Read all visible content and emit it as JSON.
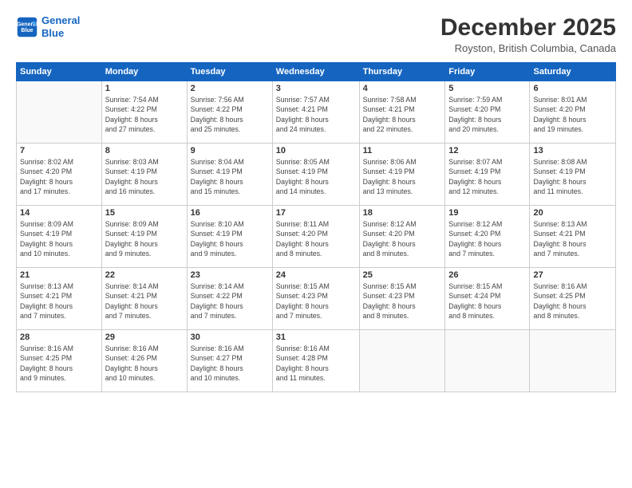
{
  "logo": {
    "line1": "General",
    "line2": "Blue"
  },
  "title": "December 2025",
  "location": "Royston, British Columbia, Canada",
  "days_header": [
    "Sunday",
    "Monday",
    "Tuesday",
    "Wednesday",
    "Thursday",
    "Friday",
    "Saturday"
  ],
  "weeks": [
    [
      {
        "num": "",
        "info": ""
      },
      {
        "num": "1",
        "info": "Sunrise: 7:54 AM\nSunset: 4:22 PM\nDaylight: 8 hours\nand 27 minutes."
      },
      {
        "num": "2",
        "info": "Sunrise: 7:56 AM\nSunset: 4:22 PM\nDaylight: 8 hours\nand 25 minutes."
      },
      {
        "num": "3",
        "info": "Sunrise: 7:57 AM\nSunset: 4:21 PM\nDaylight: 8 hours\nand 24 minutes."
      },
      {
        "num": "4",
        "info": "Sunrise: 7:58 AM\nSunset: 4:21 PM\nDaylight: 8 hours\nand 22 minutes."
      },
      {
        "num": "5",
        "info": "Sunrise: 7:59 AM\nSunset: 4:20 PM\nDaylight: 8 hours\nand 20 minutes."
      },
      {
        "num": "6",
        "info": "Sunrise: 8:01 AM\nSunset: 4:20 PM\nDaylight: 8 hours\nand 19 minutes."
      }
    ],
    [
      {
        "num": "7",
        "info": "Sunrise: 8:02 AM\nSunset: 4:20 PM\nDaylight: 8 hours\nand 17 minutes."
      },
      {
        "num": "8",
        "info": "Sunrise: 8:03 AM\nSunset: 4:19 PM\nDaylight: 8 hours\nand 16 minutes."
      },
      {
        "num": "9",
        "info": "Sunrise: 8:04 AM\nSunset: 4:19 PM\nDaylight: 8 hours\nand 15 minutes."
      },
      {
        "num": "10",
        "info": "Sunrise: 8:05 AM\nSunset: 4:19 PM\nDaylight: 8 hours\nand 14 minutes."
      },
      {
        "num": "11",
        "info": "Sunrise: 8:06 AM\nSunset: 4:19 PM\nDaylight: 8 hours\nand 13 minutes."
      },
      {
        "num": "12",
        "info": "Sunrise: 8:07 AM\nSunset: 4:19 PM\nDaylight: 8 hours\nand 12 minutes."
      },
      {
        "num": "13",
        "info": "Sunrise: 8:08 AM\nSunset: 4:19 PM\nDaylight: 8 hours\nand 11 minutes."
      }
    ],
    [
      {
        "num": "14",
        "info": "Sunrise: 8:09 AM\nSunset: 4:19 PM\nDaylight: 8 hours\nand 10 minutes."
      },
      {
        "num": "15",
        "info": "Sunrise: 8:09 AM\nSunset: 4:19 PM\nDaylight: 8 hours\nand 9 minutes."
      },
      {
        "num": "16",
        "info": "Sunrise: 8:10 AM\nSunset: 4:19 PM\nDaylight: 8 hours\nand 9 minutes."
      },
      {
        "num": "17",
        "info": "Sunrise: 8:11 AM\nSunset: 4:20 PM\nDaylight: 8 hours\nand 8 minutes."
      },
      {
        "num": "18",
        "info": "Sunrise: 8:12 AM\nSunset: 4:20 PM\nDaylight: 8 hours\nand 8 minutes."
      },
      {
        "num": "19",
        "info": "Sunrise: 8:12 AM\nSunset: 4:20 PM\nDaylight: 8 hours\nand 7 minutes."
      },
      {
        "num": "20",
        "info": "Sunrise: 8:13 AM\nSunset: 4:21 PM\nDaylight: 8 hours\nand 7 minutes."
      }
    ],
    [
      {
        "num": "21",
        "info": "Sunrise: 8:13 AM\nSunset: 4:21 PM\nDaylight: 8 hours\nand 7 minutes."
      },
      {
        "num": "22",
        "info": "Sunrise: 8:14 AM\nSunset: 4:21 PM\nDaylight: 8 hours\nand 7 minutes."
      },
      {
        "num": "23",
        "info": "Sunrise: 8:14 AM\nSunset: 4:22 PM\nDaylight: 8 hours\nand 7 minutes."
      },
      {
        "num": "24",
        "info": "Sunrise: 8:15 AM\nSunset: 4:23 PM\nDaylight: 8 hours\nand 7 minutes."
      },
      {
        "num": "25",
        "info": "Sunrise: 8:15 AM\nSunset: 4:23 PM\nDaylight: 8 hours\nand 8 minutes."
      },
      {
        "num": "26",
        "info": "Sunrise: 8:15 AM\nSunset: 4:24 PM\nDaylight: 8 hours\nand 8 minutes."
      },
      {
        "num": "27",
        "info": "Sunrise: 8:16 AM\nSunset: 4:25 PM\nDaylight: 8 hours\nand 8 minutes."
      }
    ],
    [
      {
        "num": "28",
        "info": "Sunrise: 8:16 AM\nSunset: 4:25 PM\nDaylight: 8 hours\nand 9 minutes."
      },
      {
        "num": "29",
        "info": "Sunrise: 8:16 AM\nSunset: 4:26 PM\nDaylight: 8 hours\nand 10 minutes."
      },
      {
        "num": "30",
        "info": "Sunrise: 8:16 AM\nSunset: 4:27 PM\nDaylight: 8 hours\nand 10 minutes."
      },
      {
        "num": "31",
        "info": "Sunrise: 8:16 AM\nSunset: 4:28 PM\nDaylight: 8 hours\nand 11 minutes."
      },
      {
        "num": "",
        "info": ""
      },
      {
        "num": "",
        "info": ""
      },
      {
        "num": "",
        "info": ""
      }
    ]
  ]
}
